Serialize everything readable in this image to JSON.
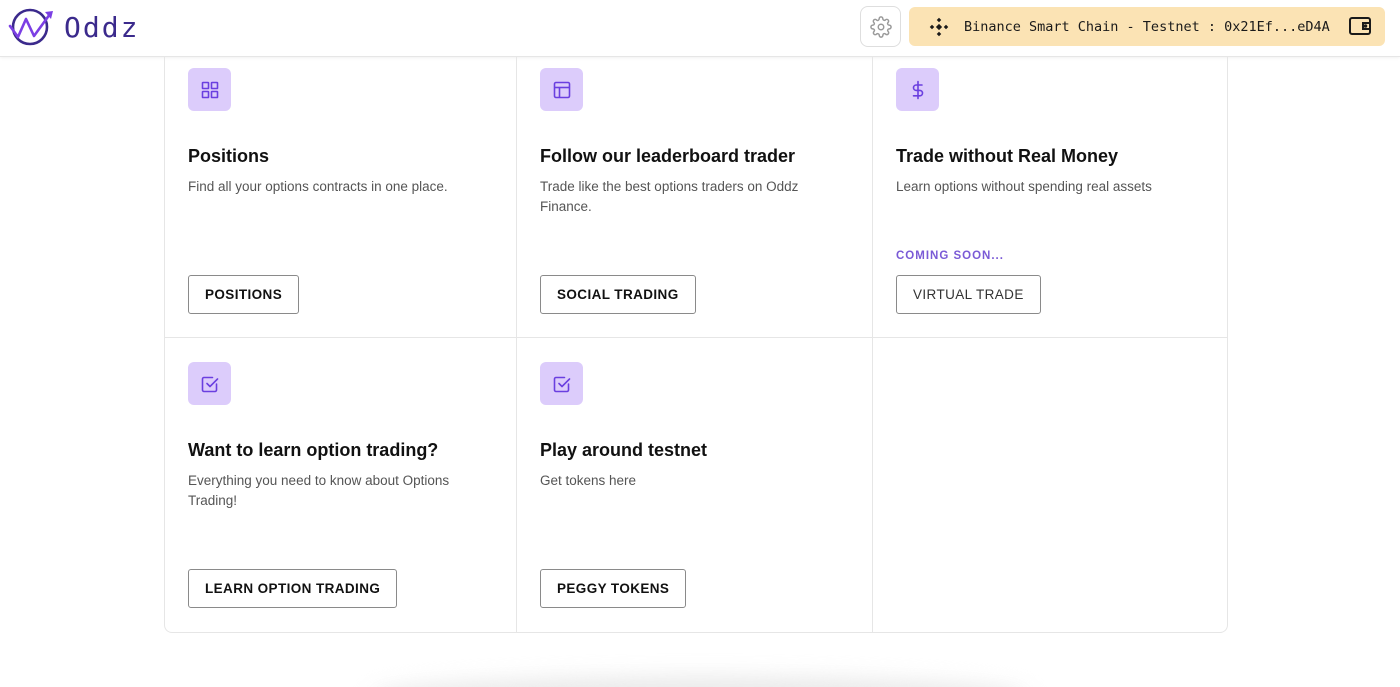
{
  "header": {
    "app_name": "Oddz",
    "wallet": {
      "network": "Binance Smart Chain - Testnet",
      "separator": " : ",
      "address": "0x21Ef...eD4A"
    }
  },
  "colors": {
    "brand": "#3b2a8c",
    "icon_bg": "#dcccfb",
    "icon_fg": "#6a3fe0",
    "wallet_bg": "#fbe3b4",
    "coming_soon": "#7a5ad6"
  },
  "cards": [
    {
      "icon": "grid-icon",
      "title": "Positions",
      "description": "Find all your options contracts in one place.",
      "button": "POSITIONS"
    },
    {
      "icon": "layout-icon",
      "title": "Follow our leaderboard trader",
      "description": "Trade like the best options traders on Oddz Finance.",
      "button": "SOCIAL TRADING"
    },
    {
      "icon": "dollar-icon",
      "title": "Trade without Real Money",
      "description": "Learn options without spending real assets",
      "badge": "COMING SOON...",
      "button": "VIRTUAL TRADE"
    },
    {
      "icon": "checkbox-icon",
      "title": "Want to learn option trading?",
      "description": "Everything you need to know about Options Trading!",
      "button": "LEARN OPTION TRADING"
    },
    {
      "icon": "checkbox-icon",
      "title": "Play around testnet",
      "description": "Get tokens here",
      "button": "PEGGY TOKENS"
    }
  ]
}
